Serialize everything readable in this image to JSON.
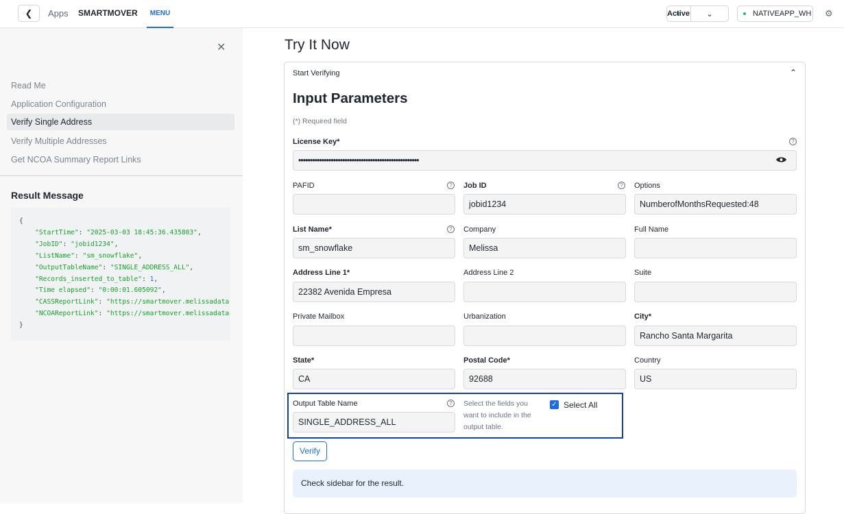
{
  "topbar": {
    "back_icon": "chevron-left-icon",
    "crumb_apps": "Apps",
    "app_name": "SMARTMOVER",
    "tab_menu": "MENU",
    "status": "Active",
    "warehouse": "NATIVEAPP_WH",
    "status_color": "#29b37f",
    "accent_color": "#1a6ce7"
  },
  "sidebar": {
    "items": [
      {
        "label": "Read Me"
      },
      {
        "label": "Application Configuration"
      },
      {
        "label": "Verify Single Address"
      },
      {
        "label": "Verify Multiple Addresses"
      },
      {
        "label": "Get NCOA Summary Report Links"
      }
    ],
    "active_index": 2,
    "result_title": "Result Message",
    "result_lines": [
      {
        "key": "StartTime",
        "value": "\"2025-03-03 18:45:36.435803\""
      },
      {
        "key": "JobID",
        "value": "\"jobid1234\""
      },
      {
        "key": "ListName",
        "value": "\"sm_snowflake\""
      },
      {
        "key": "OutputTableName",
        "value": "\"SINGLE_ADDRESS_ALL\""
      },
      {
        "key": "Records_inserted_to_table",
        "value": "1"
      },
      {
        "key": "Time elapsed",
        "value": "\"0:00:01.605092\""
      },
      {
        "key": "CASSReportLink",
        "value": "\"https://smartmover.melissadata"
      },
      {
        "key": "NCOAReportLink",
        "value": "\"https://smartmover.melissadata"
      }
    ]
  },
  "main": {
    "page_title": "Try It Now",
    "card_header": "Start Verifying",
    "params_title": "Input Parameters",
    "required_note": "(*) Required field",
    "license_key": {
      "label": "License Key*",
      "value": "••••••••••••••••••••••••••••••••••••••••••••••••••••"
    },
    "pafid": {
      "label": "PAFID",
      "value": ""
    },
    "job_id": {
      "label": "Job ID",
      "value": "jobid1234"
    },
    "options": {
      "label": "Options",
      "value": "NumberofMonthsRequested:48"
    },
    "list_name": {
      "label": "List Name*",
      "value": "sm_snowflake"
    },
    "company": {
      "label": "Company",
      "value": "Melissa"
    },
    "full_name": {
      "label": "Full Name",
      "value": ""
    },
    "address1": {
      "label": "Address Line 1*",
      "value": "22382 Avenida Empresa"
    },
    "address2": {
      "label": "Address Line 2",
      "value": ""
    },
    "suite": {
      "label": "Suite",
      "value": ""
    },
    "pmb": {
      "label": "Private Mailbox",
      "value": ""
    },
    "urbanization": {
      "label": "Urbanization",
      "value": ""
    },
    "city": {
      "label": "City*",
      "value": "Rancho Santa Margarita"
    },
    "state": {
      "label": "State*",
      "value": "CA"
    },
    "postal": {
      "label": "Postal Code*",
      "value": "92688"
    },
    "country": {
      "label": "Country",
      "value": "US"
    },
    "output_table": {
      "label": "Output Table Name",
      "value": "SINGLE_ADDRESS_ALL"
    },
    "fields_hint": "Select the fields you want to include in the output table.",
    "select_all": {
      "label": "Select All",
      "checked": true
    },
    "verify_button": "Verify",
    "info_message": "Check sidebar for the result.",
    "highlight_color": "#1238d4"
  }
}
